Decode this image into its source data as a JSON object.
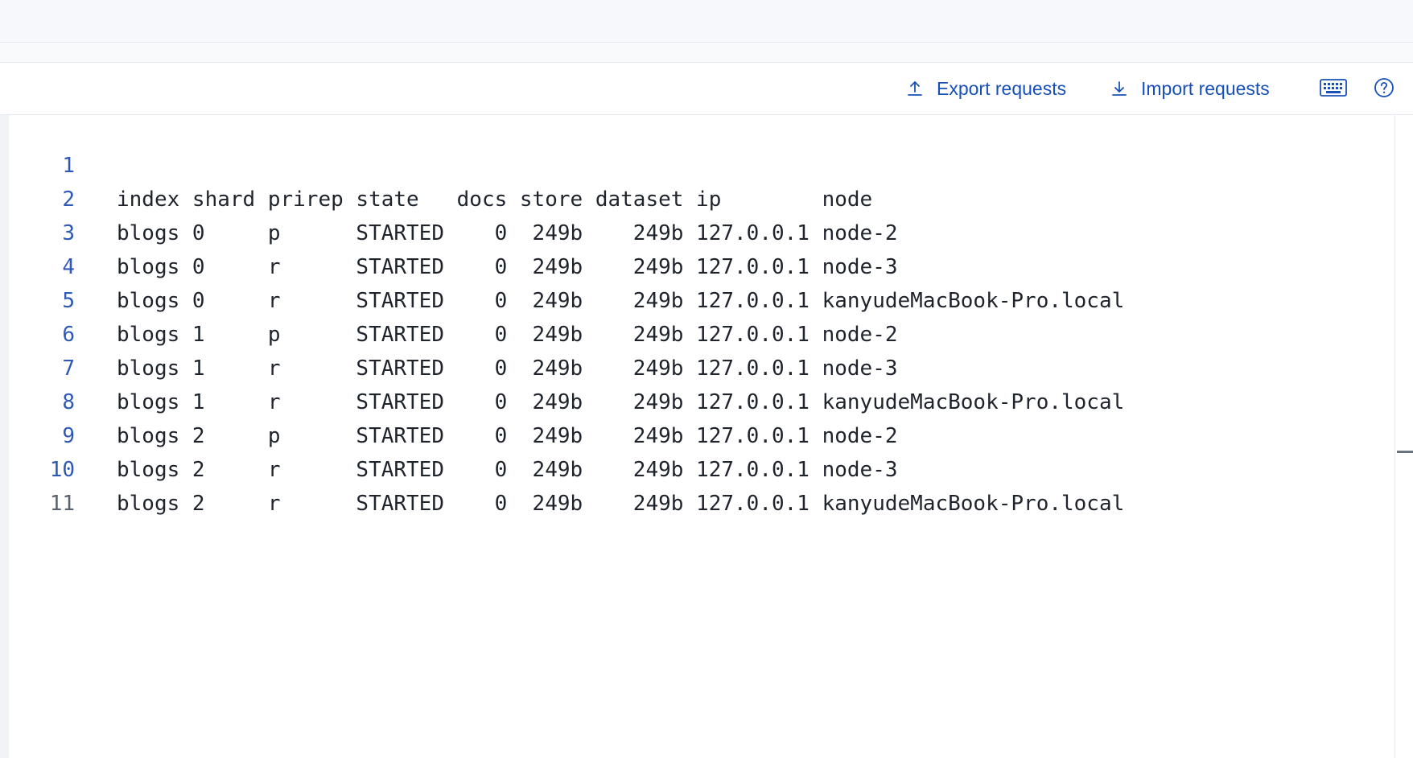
{
  "toolbar": {
    "export_label": "Export requests",
    "import_label": "Import requests",
    "export_icon": "upload-icon",
    "import_icon": "download-icon",
    "keyboard_icon": "keyboard-icon",
    "help_icon": "help-icon"
  },
  "editor": {
    "lines": [
      {
        "num": "1",
        "text": "index shard prirep state   docs store dataset ip        node"
      },
      {
        "num": "2",
        "text": "blogs 0     p      STARTED    0  249b    249b 127.0.0.1 node-2"
      },
      {
        "num": "3",
        "text": "blogs 0     r      STARTED    0  249b    249b 127.0.0.1 node-3"
      },
      {
        "num": "4",
        "text": "blogs 0     r      STARTED    0  249b    249b 127.0.0.1 kanyudeMacBook-Pro.local"
      },
      {
        "num": "5",
        "text": "blogs 1     p      STARTED    0  249b    249b 127.0.0.1 node-2"
      },
      {
        "num": "6",
        "text": "blogs 1     r      STARTED    0  249b    249b 127.0.0.1 node-3"
      },
      {
        "num": "7",
        "text": "blogs 1     r      STARTED    0  249b    249b 127.0.0.1 kanyudeMacBook-Pro.local"
      },
      {
        "num": "8",
        "text": "blogs 2     p      STARTED    0  249b    249b 127.0.0.1 node-2"
      },
      {
        "num": "9",
        "text": "blogs 2     r      STARTED    0  249b    249b 127.0.0.1 node-3"
      },
      {
        "num": "10",
        "text": "blogs 2     r      STARTED    0  249b    249b 127.0.0.1 kanyudeMacBook-Pro.local"
      },
      {
        "num": "11",
        "text": ""
      }
    ]
  },
  "colors": {
    "accent": "#1750ba",
    "line_number": "#2e59b7",
    "text": "#1f242c"
  }
}
